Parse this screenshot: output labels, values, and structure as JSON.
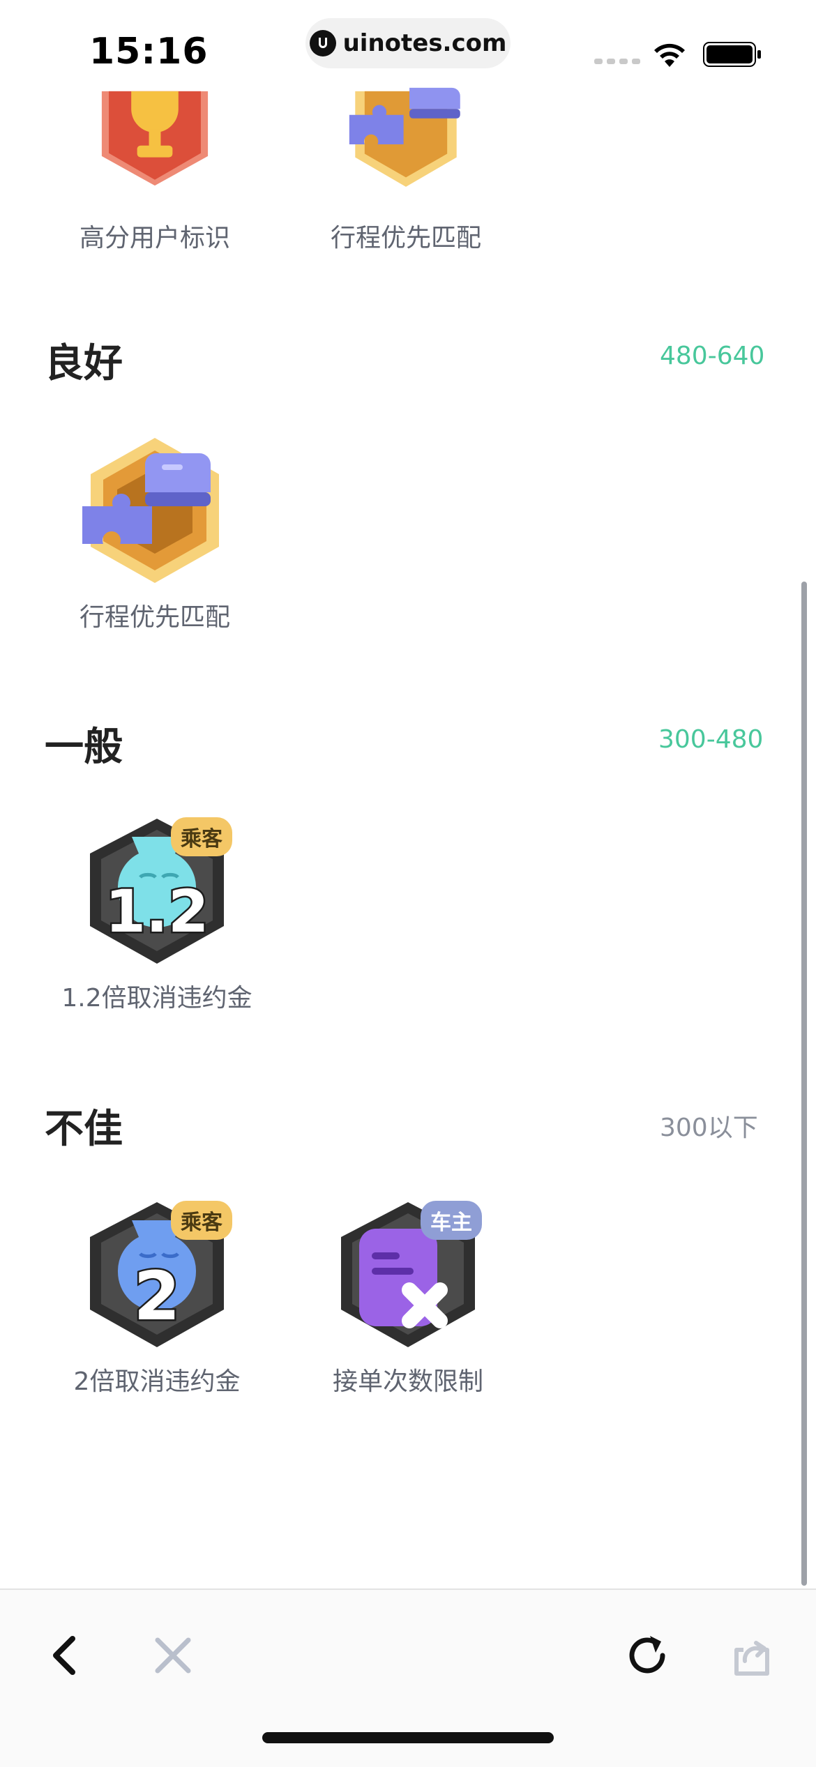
{
  "status_bar": {
    "time": "15:16",
    "url": "uinotes.com"
  },
  "top_row": [
    {
      "label": "高分用户标识",
      "icon": "trophy-badge-icon"
    },
    {
      "label": "行程优先匹配",
      "icon": "puzzle-badge-icon"
    }
  ],
  "sections": [
    {
      "title": "良好",
      "range": "480-640",
      "badges": [
        {
          "label": "行程优先匹配",
          "icon": "puzzle-badge-icon"
        }
      ]
    },
    {
      "title": "一般",
      "range": "300-480",
      "badges": [
        {
          "label": "1.2倍取消违约金",
          "icon": "money-bag-badge-icon",
          "chip": "乘客",
          "number": "1.2"
        }
      ]
    },
    {
      "title": "不佳",
      "range": "300以下",
      "badges": [
        {
          "label": "2倍取消违约金",
          "icon": "money-bag-badge-icon",
          "chip": "乘客",
          "number": "2"
        },
        {
          "label": "接单次数限制",
          "icon": "order-limit-badge-icon",
          "chip": "车主"
        }
      ]
    }
  ],
  "colors": {
    "range_green": "#48c79b",
    "range_gray": "#8a8f9a",
    "passenger_chip": "#f4c766",
    "driver_chip": "#8f9ed5"
  },
  "toolbar": {
    "icons": [
      "back-icon",
      "close-icon",
      "reload-icon",
      "share-icon"
    ]
  }
}
